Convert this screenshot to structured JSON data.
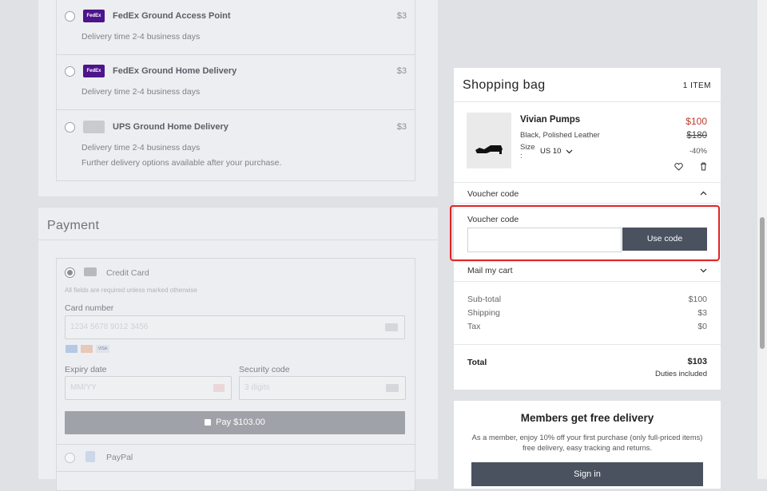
{
  "shipping": {
    "options": [
      {
        "name": "FedEx Ground Access Point",
        "price": "$3",
        "time": "Delivery time 2-4 business days",
        "logo": "FedEx"
      },
      {
        "name": "FedEx Ground Home Delivery",
        "price": "$3",
        "time": "Delivery time 2-4 business days",
        "logo": "FedEx"
      },
      {
        "name": "UPS Ground Home Delivery",
        "price": "$3",
        "time": "Delivery time 2-4 business days",
        "note": "Further delivery options available after your purchase."
      }
    ]
  },
  "payment": {
    "title": "Payment",
    "credit_card_label": "Credit Card",
    "required_note": "All fields are required unless marked otherwise",
    "card_number_label": "Card number",
    "card_number_placeholder": "1234 5678 9012 3456",
    "expiry_label": "Expiry date",
    "expiry_placeholder": "MM/YY",
    "security_label": "Security code",
    "security_placeholder": "3 digits",
    "pay_button": "Pay $103.00",
    "paypal_label": "PayPal"
  },
  "bag": {
    "title": "Shopping bag",
    "count": "1 ITEM",
    "product": {
      "name": "Vivian Pumps",
      "description": "Black, Polished Leather",
      "size_label": "Size :",
      "size_value": "US 10",
      "price": "$100",
      "original_price": "$180",
      "discount": "-40%"
    },
    "voucher_header": "Voucher code",
    "voucher_label": "Voucher code",
    "voucher_value": "",
    "voucher_button": "Use code",
    "mail_cart": "Mail my cart",
    "subtotal_label": "Sub-total",
    "subtotal": "$100",
    "shipping_label": "Shipping",
    "shipping": "$3",
    "tax_label": "Tax",
    "tax": "$0",
    "total_label": "Total",
    "total": "$103",
    "duties": "Duties included"
  },
  "members": {
    "title": "Members get free delivery",
    "text": "As a member, enjoy 10% off your first purchase (only full-priced items) free delivery, easy tracking and returns.",
    "signin": "Sign in"
  },
  "colors": {
    "accent": "#4a5260",
    "sale": "#c0392b",
    "highlight": "#e02424"
  }
}
